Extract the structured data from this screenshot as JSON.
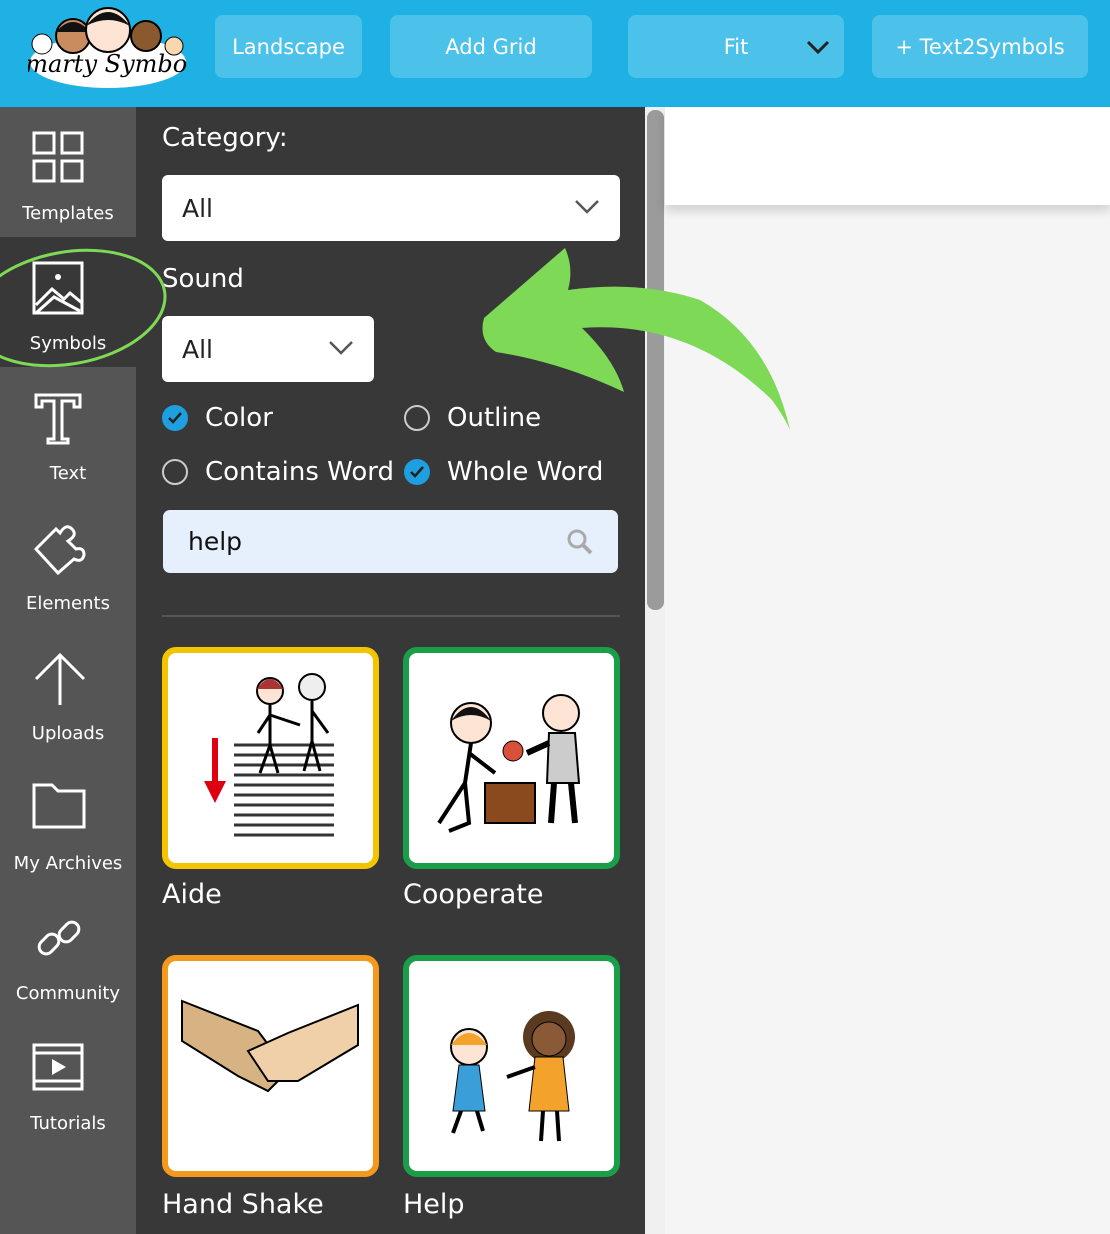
{
  "header": {
    "logo_text": "Smarty Symbols",
    "buttons": [
      {
        "label": "Landscape"
      },
      {
        "label": "Add Grid"
      },
      {
        "label": "Fit"
      },
      {
        "label": "+ Text2Symbols"
      }
    ]
  },
  "sidebar": {
    "items": [
      {
        "label": "Templates",
        "icon": "grid-icon"
      },
      {
        "label": "Symbols",
        "icon": "image-icon",
        "active": true
      },
      {
        "label": "Text",
        "icon": "text-icon"
      },
      {
        "label": "Elements",
        "icon": "puzzle-icon"
      },
      {
        "label": "Uploads",
        "icon": "arrow-up-icon"
      },
      {
        "label": "My Archives",
        "icon": "folder-icon"
      },
      {
        "label": "Community",
        "icon": "link-icon"
      },
      {
        "label": "Tutorials",
        "icon": "film-icon"
      }
    ]
  },
  "panel": {
    "category_label": "Category:",
    "category_value": "All",
    "sound_label": "Sound",
    "sound_value": "All",
    "options": {
      "color": "Color",
      "outline": "Outline",
      "contains_word": "Contains Word",
      "whole_word": "Whole Word"
    },
    "option_state": {
      "color": true,
      "outline": false,
      "contains_word": false,
      "whole_word": true
    },
    "search_value": "help",
    "symbols": [
      {
        "label": "Aide",
        "border": "#f2c500"
      },
      {
        "label": "Cooperate",
        "border": "#1a9e4a"
      },
      {
        "label": "Hand Shake",
        "border": "#f39a1e"
      },
      {
        "label": "Help",
        "border": "#1a9e4a"
      }
    ]
  },
  "colors": {
    "header": "#1fb1e3",
    "accent": "#1e9fe0",
    "annotation": "#7ed957"
  }
}
